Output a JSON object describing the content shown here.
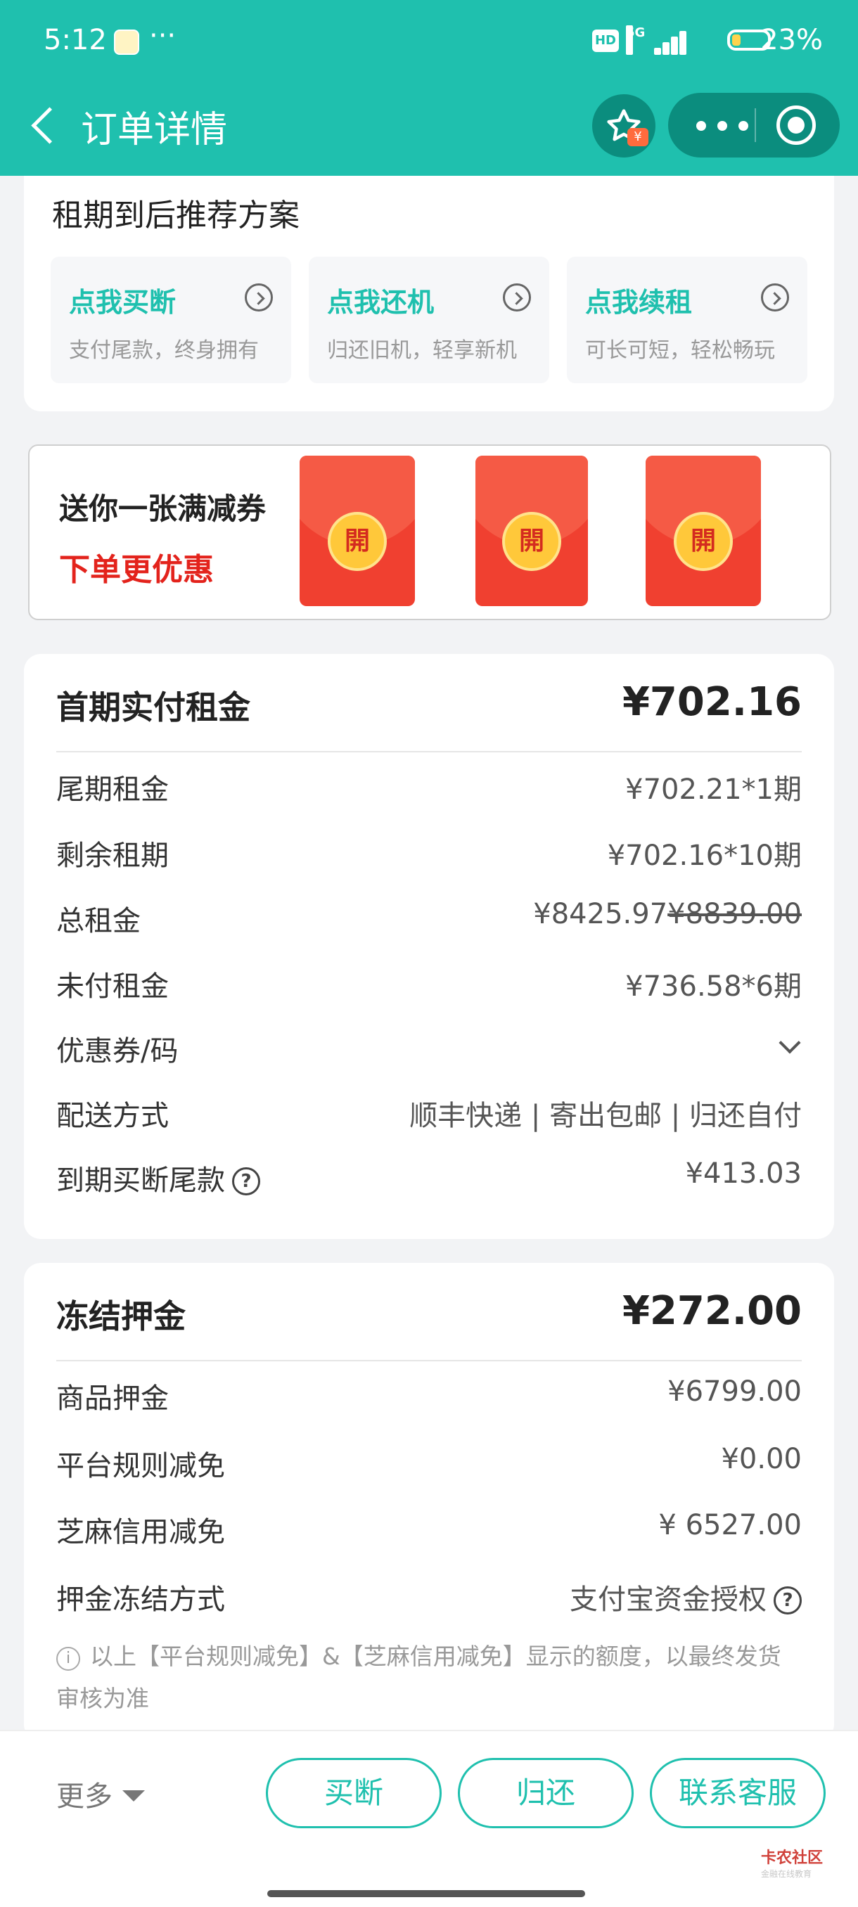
{
  "status_bar": {
    "time": "5:12",
    "dots": "···",
    "hd": "HD",
    "network": "5G",
    "battery": "23%"
  },
  "navbar": {
    "title": "订单详情"
  },
  "plan": {
    "title": "租期到后推荐方案",
    "options": [
      {
        "title": "点我买断",
        "subtitle": "支付尾款，终身拥有"
      },
      {
        "title": "点我还机",
        "subtitle": "归还旧机，轻享新机"
      },
      {
        "title": "点我续租",
        "subtitle": "可长可短，轻松畅玩"
      }
    ]
  },
  "coupon": {
    "line1": "送你一张满减券",
    "line2": "下单更优惠",
    "packet_label": "開"
  },
  "rent": {
    "title": "首期实付租金",
    "amount": "¥702.16",
    "rows": [
      {
        "label": "尾期租金",
        "value": "¥702.21*1期"
      },
      {
        "label": "剩余租期",
        "value": "¥702.16*10期"
      },
      {
        "label": "总租金",
        "value": "¥8425.97",
        "value_struck": "¥8839.00"
      },
      {
        "label": "未付租金",
        "value": "¥736.58*6期"
      },
      {
        "label": "优惠券/码",
        "value": ""
      },
      {
        "label": "配送方式",
        "value": "顺丰快递 | 寄出包邮 | 归还自付"
      },
      {
        "label": "到期买断尾款",
        "value": "¥413.03"
      }
    ]
  },
  "deposit": {
    "title": "冻结押金",
    "amount": "¥272.00",
    "rows": [
      {
        "label": "商品押金",
        "value": "¥6799.00"
      },
      {
        "label": "平台规则减免",
        "value": "¥0.00"
      },
      {
        "label": "芝麻信用减免",
        "value": "¥ 6527.00"
      },
      {
        "label": "押金冻结方式",
        "value": "支付宝资金授权"
      }
    ],
    "note": "以上【平台规则减免】&【芝麻信用减免】显示的额度，以最终发货审核为准"
  },
  "bottom_bar": {
    "more": "更多",
    "buttons": [
      "买断",
      "归还",
      "联系客服"
    ],
    "watermark": "卡农社区",
    "watermark_sub": "金融在线教育"
  },
  "colors": {
    "primary": "#1fc0ae",
    "primary_dark": "#0b8d7e",
    "red": "#e3231c"
  }
}
